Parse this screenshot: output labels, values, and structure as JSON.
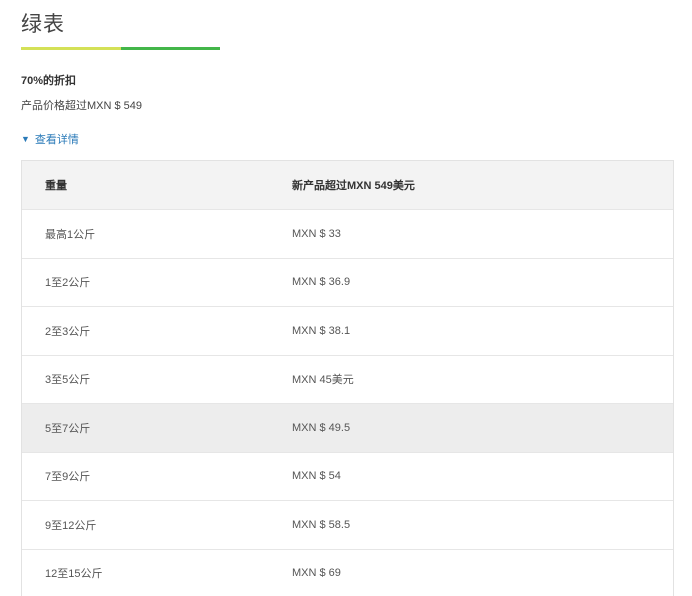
{
  "header": {
    "title": "绿表",
    "bar_colors": [
      "#d4e157",
      "#43b649"
    ]
  },
  "promo": {
    "discount": "70%的折扣",
    "condition": "产品价格超过MXN $ 549",
    "details_label": "查看详情"
  },
  "table": {
    "columns": [
      "重量",
      "新产品超过MXN 549美元"
    ],
    "rows": [
      {
        "weight": "最高1公斤",
        "price": "MXN $ 33"
      },
      {
        "weight": "1至2公斤",
        "price": "MXN $ 36.9"
      },
      {
        "weight": "2至3公斤",
        "price": "MXN $ 38.1"
      },
      {
        "weight": "3至5公斤",
        "price": "MXN 45美元"
      },
      {
        "weight": "5至7公斤",
        "price": "MXN $ 49.5"
      },
      {
        "weight": "7至9公斤",
        "price": "MXN $ 54"
      },
      {
        "weight": "9至12公斤",
        "price": "MXN $ 58.5"
      },
      {
        "weight": "12至15公斤",
        "price": "MXN $ 69"
      }
    ]
  }
}
